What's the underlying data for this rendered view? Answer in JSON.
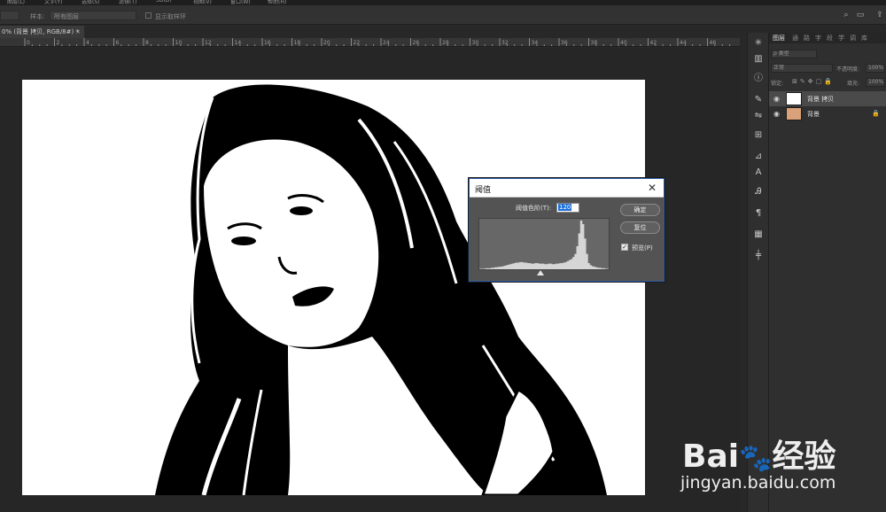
{
  "menubar": {
    "items": [
      "图层(L)",
      "文字(Y)",
      "选择(S)",
      "滤镜(T)",
      "3D(D)",
      "视图(V)",
      "窗口(W)",
      "帮助(H)"
    ]
  },
  "optbar": {
    "sample_label": "样本:",
    "sample_value": "所有图层",
    "show_ring_label": "显示取样环"
  },
  "document": {
    "tab_title": "0% (背景 拷贝, RGB/8#) *",
    "close_glyph": "×",
    "ruler_ticks": [
      "0",
      "2",
      "4",
      "6",
      "8",
      "10",
      "12",
      "14",
      "16",
      "18",
      "20",
      "22",
      "24",
      "26",
      "28",
      "30",
      "32",
      "34",
      "36",
      "38",
      "40",
      "42",
      "44",
      "46"
    ]
  },
  "layers_panel": {
    "tabs": [
      "图层",
      "通",
      "路",
      "字",
      "段",
      "学",
      "调",
      "库"
    ],
    "kind_filter": "ρ 类型",
    "blend_mode": "正常",
    "opacity_label": "不透明度:",
    "opacity_value": "100%",
    "lock_label": "锁定:",
    "fill_label": "填充:",
    "fill_value": "100%",
    "layers": [
      {
        "name": "背景 拷贝",
        "locked": false,
        "selected": true
      },
      {
        "name": "背景",
        "locked": true,
        "selected": false
      }
    ]
  },
  "threshold_dialog": {
    "title": "阈值",
    "close_glyph": "✕",
    "level_label": "阈值色阶(T):",
    "level_value": "120",
    "ok_label": "确定",
    "reset_label": "复位",
    "preview_label": "预览(P)",
    "preview_checked": true,
    "histogram": [
      1,
      1,
      1,
      2,
      2,
      2,
      3,
      3,
      4,
      4,
      5,
      5,
      6,
      7,
      8,
      9,
      10,
      11,
      12,
      13,
      13,
      14,
      14,
      13,
      13,
      12,
      12,
      11,
      11,
      12,
      12,
      11,
      11,
      11,
      10,
      10,
      11,
      11,
      10,
      10,
      11,
      11,
      12,
      12,
      13,
      14,
      16,
      18,
      20,
      24,
      30,
      45,
      70,
      95,
      88,
      60,
      30,
      12,
      8,
      6,
      5,
      4,
      3,
      3,
      2,
      2,
      1,
      1
    ],
    "threshold_fraction": 0.47
  },
  "watermark": {
    "logo": "Bai🐾经验",
    "url": "jingyan.baidu.com"
  },
  "colors": {
    "accent_selection": "#1c6fd6",
    "panel": "#2f2f2f",
    "dialog_bg": "#535353",
    "histogram_bar": "#d6d6d6"
  }
}
